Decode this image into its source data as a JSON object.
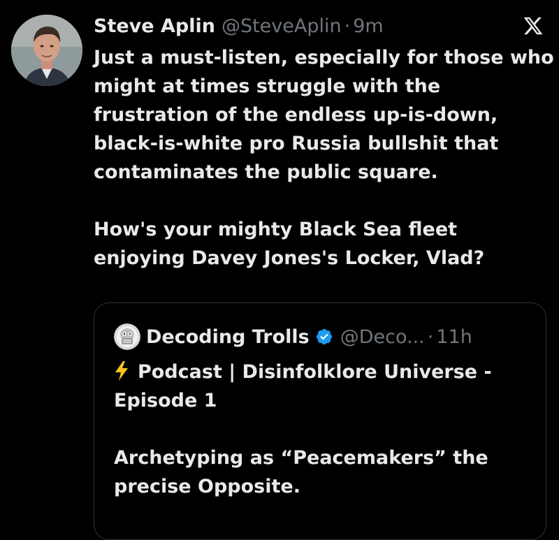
{
  "post": {
    "author_name": "Steve Aplin",
    "author_handle": "@SteveAplin",
    "separator": "·",
    "time": "9m",
    "paragraph_1": "Just a must-listen, especially for those who might at times struggle with the frustration of the endless up-is-down, black-is-white pro Russia bullshit that contaminates the public square.",
    "paragraph_2": "How's your mighty Black Sea fleet enjoying Davey Jones's Locker, Vlad?",
    "logo_icon": "x-logo-icon"
  },
  "quote": {
    "author_name": "Decoding Trolls",
    "author_handle": "@Deco...",
    "separator": "·",
    "time": "11h",
    "verified_color": "#1d9bf0",
    "line_1": "Podcast | Disinfolklore Universe - Episode 1",
    "line_2": "Archetyping as “Peacemakers” the precise Opposite.",
    "bolt_icon": "lightning-bolt-icon"
  },
  "colors": {
    "background": "#000000",
    "text_primary": "#e7e9ea",
    "text_secondary": "#71767b",
    "card_border": "#2f3336"
  }
}
